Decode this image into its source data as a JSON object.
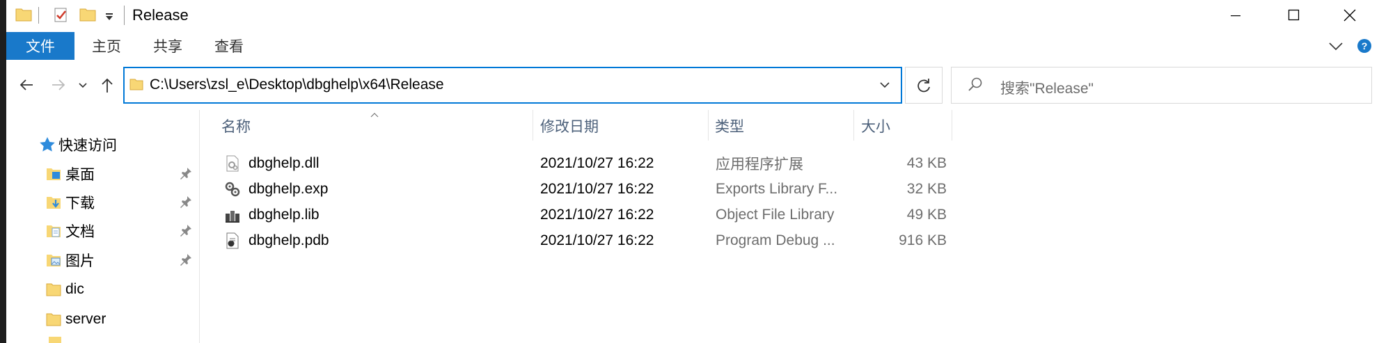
{
  "window": {
    "title": "Release",
    "controls": [
      "minimize-icon",
      "maximize-icon",
      "close-icon"
    ]
  },
  "ribbon": {
    "tabs": [
      {
        "label": "文件",
        "active": true
      },
      {
        "label": "主页"
      },
      {
        "label": "共享"
      },
      {
        "label": "查看"
      }
    ]
  },
  "address": {
    "path": "C:\\Users\\zsl_e\\Desktop\\dbghelp\\x64\\Release"
  },
  "search": {
    "placeholder": "搜索\"Release\""
  },
  "nav": {
    "quick_access": "快速访问",
    "items": [
      {
        "label": "桌面",
        "icon": "desktop-folder-icon",
        "pinned": true
      },
      {
        "label": "下载",
        "icon": "downloads-folder-icon",
        "pinned": true
      },
      {
        "label": "文档",
        "icon": "documents-folder-icon",
        "pinned": true
      },
      {
        "label": "图片",
        "icon": "pictures-folder-icon",
        "pinned": true
      },
      {
        "label": "dic",
        "icon": "folder-icon",
        "pinned": false
      },
      {
        "label": "server",
        "icon": "folder-icon",
        "pinned": false
      }
    ]
  },
  "columns": {
    "name": "名称",
    "modified": "修改日期",
    "type": "类型",
    "size": "大小"
  },
  "files": [
    {
      "name": "dbghelp.dll",
      "modified": "2021/10/27 16:22",
      "type": "应用程序扩展",
      "size": "43 KB",
      "icon": "dll-file-icon"
    },
    {
      "name": "dbghelp.exp",
      "modified": "2021/10/27 16:22",
      "type": "Exports Library F...",
      "size": "32 KB",
      "icon": "exp-file-icon"
    },
    {
      "name": "dbghelp.lib",
      "modified": "2021/10/27 16:22",
      "type": "Object File Library",
      "size": "49 KB",
      "icon": "lib-file-icon"
    },
    {
      "name": "dbghelp.pdb",
      "modified": "2021/10/27 16:22",
      "type": "Program Debug ...",
      "size": "916 KB",
      "icon": "pdb-file-icon"
    }
  ],
  "colors": {
    "accent": "#0078d7",
    "file_tab": "#1979ca",
    "header_text": "#4c607a",
    "folder": "#f8d775"
  }
}
